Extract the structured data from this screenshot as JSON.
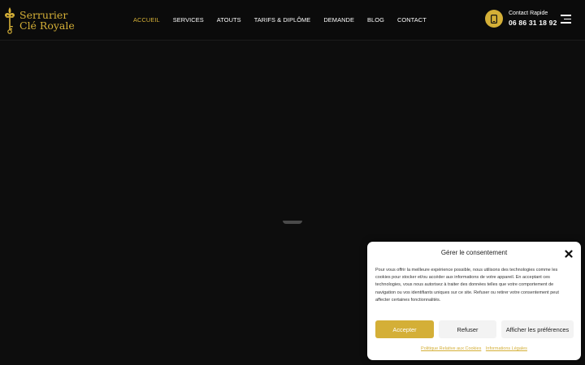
{
  "header": {
    "logo_line1": "Serrurier",
    "logo_line2": "Clé Royale",
    "nav": [
      "ACCUEIL",
      "SERVICES",
      "ATOUTS",
      "TARIFS & DIPLÔME",
      "DEMANDE",
      "BLOG",
      "CONTACT"
    ],
    "active_nav": "ACCUEIL",
    "contact_label": "Contact Rapide",
    "contact_phone": "06 86 31 18 92"
  },
  "consent": {
    "title": "Gérer le consentement",
    "body": "Pour vous offrir la meilleure expérience possible, nous utilisons des technologies comme les cookies pour stocker et/ou accéder aux informations de votre appareil. En acceptant ces technologies, vous nous autorisez à traiter des données telles que votre comportement de navigation ou vos identifiants uniques sur ce site. Refuser ou retirer votre consentement peut affecter certaines fonctionnalités.",
    "accept": "Accepter",
    "refuse": "Refuser",
    "preferences": "Afficher les préférences",
    "link_cookies": "Politique Relative aux Cookies",
    "link_legal": "Informations Légales"
  },
  "colors": {
    "accent": "#d4af37",
    "background": "#0d0d0d",
    "header": "#0b0b0b"
  },
  "icons": {
    "logo": "fleur-de-lis-key-icon",
    "contact": "phone-icon",
    "menu": "hamburger-menu-icon",
    "close": "close-icon"
  }
}
